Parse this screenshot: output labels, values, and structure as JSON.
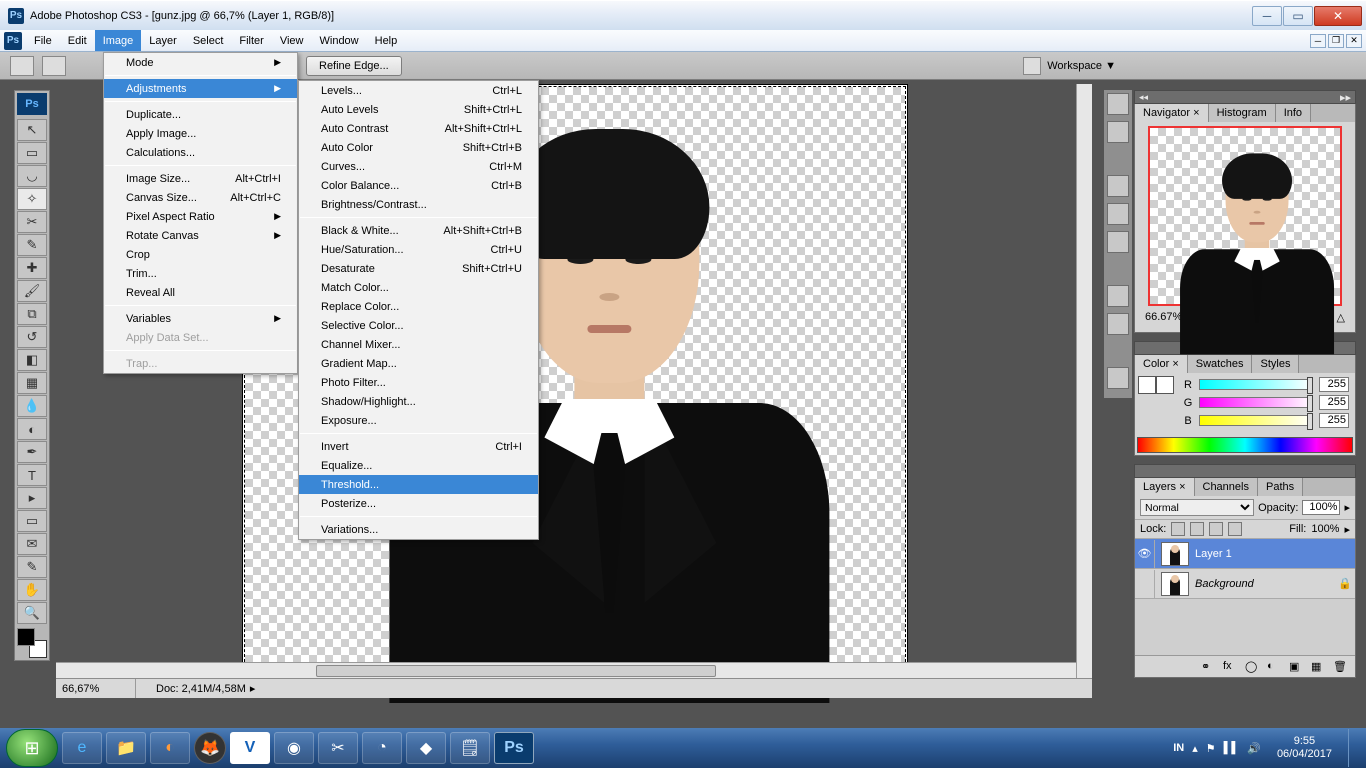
{
  "title": "Adobe Photoshop CS3 - [gunz.jpg @ 66,7% (Layer 1, RGB/8)]",
  "menu": {
    "file": "File",
    "edit": "Edit",
    "image": "Image",
    "layer": "Layer",
    "select": "Select",
    "filter": "Filter",
    "view": "View",
    "window": "Window",
    "help": "Help"
  },
  "optbar": {
    "refine": "Refine Edge...",
    "workspace": "Workspace ▼"
  },
  "imageMenu": {
    "mode": "Mode",
    "adjustments": "Adjustments",
    "duplicate": "Duplicate...",
    "apply": "Apply Image...",
    "calc": "Calculations...",
    "imageSize": "Image Size...",
    "imageSizeK": "Alt+Ctrl+I",
    "canvasSize": "Canvas Size...",
    "canvasSizeK": "Alt+Ctrl+C",
    "par": "Pixel Aspect Ratio",
    "rotate": "Rotate Canvas",
    "crop": "Crop",
    "trim": "Trim...",
    "reveal": "Reveal All",
    "variables": "Variables",
    "applyData": "Apply Data Set...",
    "trap": "Trap..."
  },
  "adjust": {
    "levels": "Levels...",
    "levelsK": "Ctrl+L",
    "autoLevels": "Auto Levels",
    "autoLevelsK": "Shift+Ctrl+L",
    "autoContrast": "Auto Contrast",
    "autoContrastK": "Alt+Shift+Ctrl+L",
    "autoColor": "Auto Color",
    "autoColorK": "Shift+Ctrl+B",
    "curves": "Curves...",
    "curvesK": "Ctrl+M",
    "colorBal": "Color Balance...",
    "colorBalK": "Ctrl+B",
    "bc": "Brightness/Contrast...",
    "bw": "Black & White...",
    "bwK": "Alt+Shift+Ctrl+B",
    "hue": "Hue/Saturation...",
    "hueK": "Ctrl+U",
    "desat": "Desaturate",
    "desatK": "Shift+Ctrl+U",
    "match": "Match Color...",
    "replace": "Replace Color...",
    "selective": "Selective Color...",
    "mixer": "Channel Mixer...",
    "gmap": "Gradient Map...",
    "pfilter": "Photo Filter...",
    "shadow": "Shadow/Highlight...",
    "exposure": "Exposure...",
    "invert": "Invert",
    "invertK": "Ctrl+I",
    "equalize": "Equalize...",
    "threshold": "Threshold...",
    "posterize": "Posterize...",
    "variations": "Variations..."
  },
  "status": {
    "zoom": "66,67%",
    "doc": "Doc: 2,41M/4,58M"
  },
  "nav": {
    "tab1": "Navigator ×",
    "tab2": "Histogram",
    "tab3": "Info",
    "zoom": "66.67%"
  },
  "color": {
    "tab1": "Color ×",
    "tab2": "Swatches",
    "tab3": "Styles",
    "r": "R",
    "g": "G",
    "b": "B",
    "rv": "255",
    "gv": "255",
    "bv": "255"
  },
  "layers": {
    "tab1": "Layers ×",
    "tab2": "Channels",
    "tab3": "Paths",
    "blend": "Normal",
    "opacityL": "Opacity:",
    "opacity": "100%",
    "lockL": "Lock:",
    "fillL": "Fill:",
    "fill": "100%",
    "l1": "Layer 1",
    "l2": "Background"
  },
  "tray": {
    "lang": "IN",
    "time": "9:55",
    "date": "06/04/2017"
  },
  "panelHdr": {
    "seek": "▸▸"
  }
}
